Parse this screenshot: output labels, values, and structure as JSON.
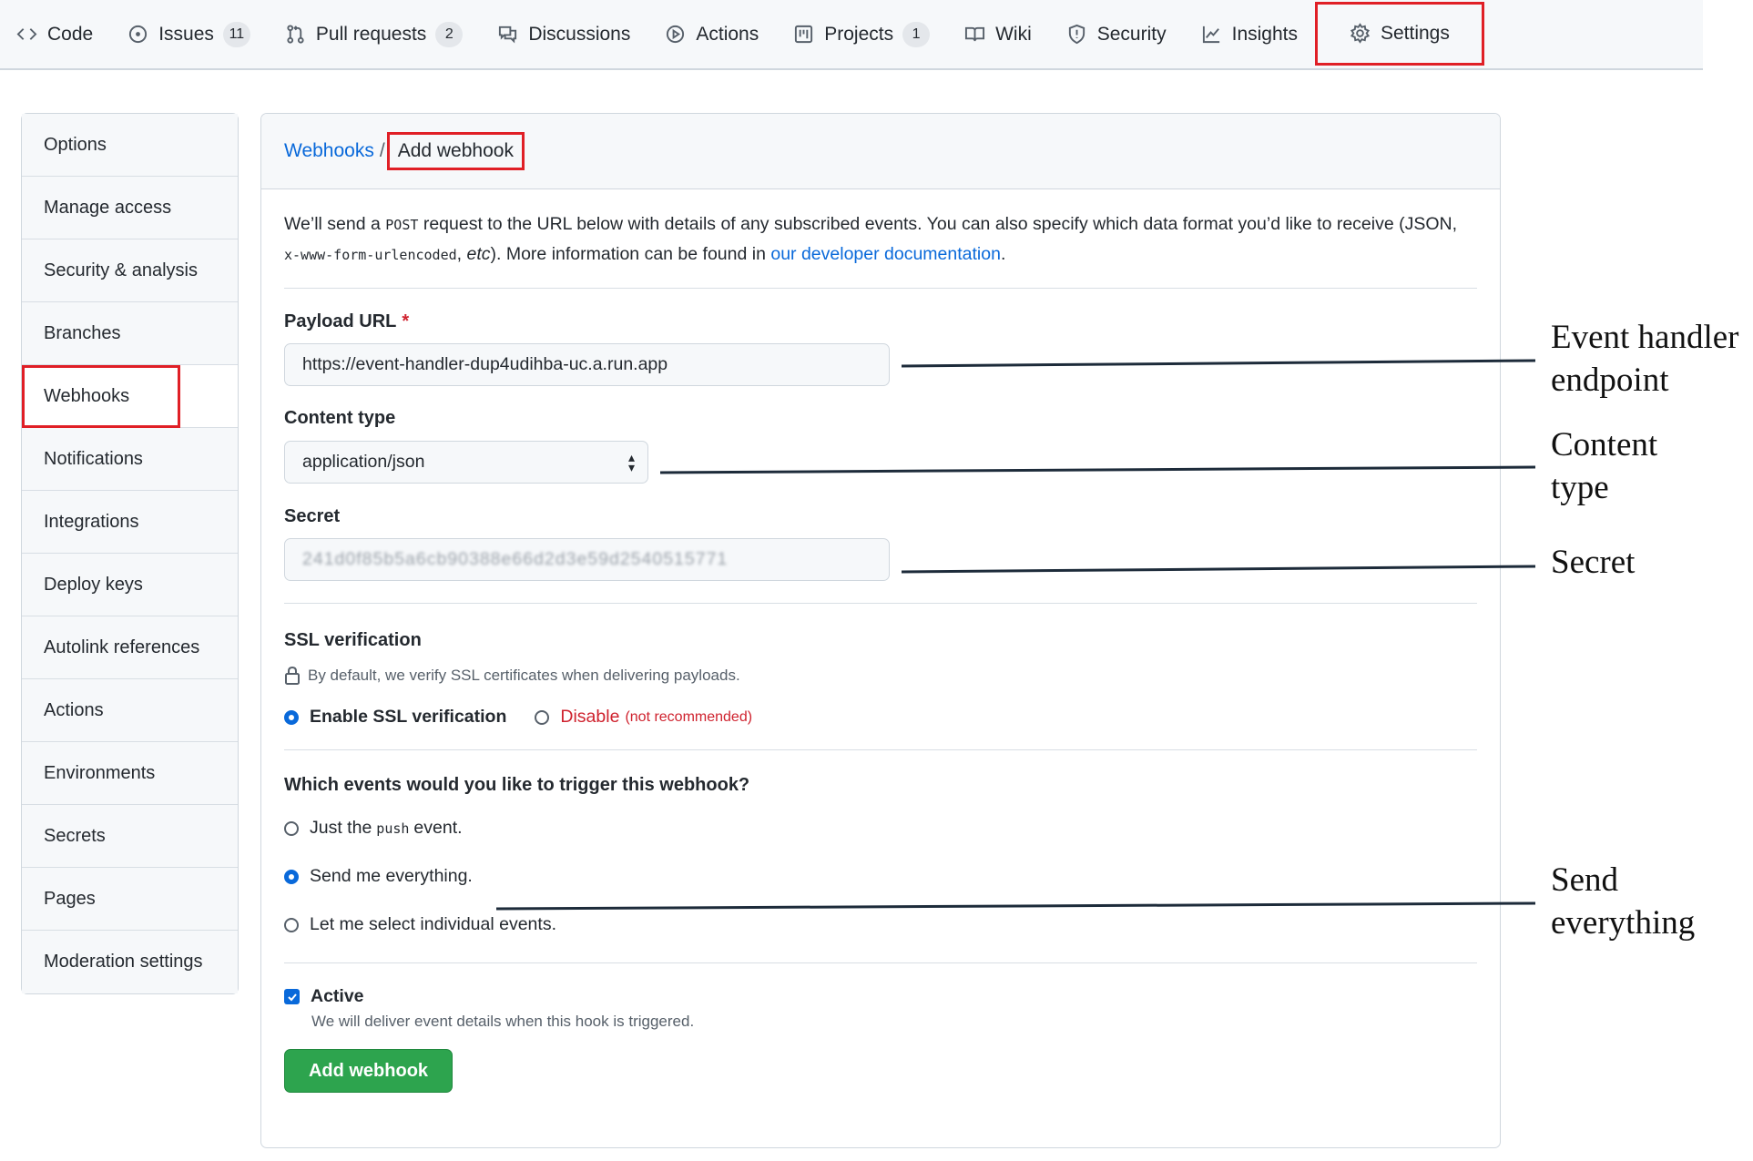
{
  "nav": {
    "tabs": [
      {
        "label": "Code",
        "icon": "code-icon",
        "count": ""
      },
      {
        "label": "Issues",
        "icon": "issue-icon",
        "count": "11"
      },
      {
        "label": "Pull requests",
        "icon": "pull-request-icon",
        "count": "2"
      },
      {
        "label": "Discussions",
        "icon": "discussion-icon",
        "count": ""
      },
      {
        "label": "Actions",
        "icon": "play-icon",
        "count": ""
      },
      {
        "label": "Projects",
        "icon": "project-icon",
        "count": "1"
      },
      {
        "label": "Wiki",
        "icon": "book-icon",
        "count": ""
      },
      {
        "label": "Security",
        "icon": "shield-icon",
        "count": ""
      },
      {
        "label": "Insights",
        "icon": "graph-icon",
        "count": ""
      },
      {
        "label": "Settings",
        "icon": "gear-icon",
        "count": ""
      }
    ],
    "selected": "Settings"
  },
  "sidebar": {
    "items": [
      "Options",
      "Manage access",
      "Security & analysis",
      "Branches",
      "Webhooks",
      "Notifications",
      "Integrations",
      "Deploy keys",
      "Autolink references",
      "Actions",
      "Environments",
      "Secrets",
      "Pages",
      "Moderation settings"
    ],
    "active": "Webhooks"
  },
  "breadcrumb": {
    "parent": "Webhooks",
    "separator": "/",
    "current": "Add webhook"
  },
  "intro": {
    "p1": "We’ll send a ",
    "post": "POST",
    "p2": " request to the URL below with details of any subscribed events. You can also specify which data format you’d like to receive (JSON, ",
    "form": "x-www-form-urlencoded",
    "p3": ", ",
    "etc": "etc",
    "p4": "). More information can be found in ",
    "link": "our developer documentation",
    "p5": "."
  },
  "payload": {
    "label": "Payload URL",
    "required": "*",
    "value": "https://event-handler-dup4udihba-uc.a.run.app"
  },
  "content_type": {
    "label": "Content type",
    "value": "application/json"
  },
  "secret": {
    "label": "Secret",
    "value": "241d0f85b5a6cb90388e66d2d3e59d2540515771"
  },
  "ssl": {
    "label": "SSL verification",
    "note": "By default, we verify SSL certificates when delivering payloads.",
    "enable": "Enable SSL verification",
    "disable": "Disable",
    "disable_note": "(not recommended)"
  },
  "events": {
    "question": "Which events would you like to trigger this webhook?",
    "opt1_pre": "Just the ",
    "opt1_code": "push",
    "opt1_post": " event.",
    "opt2": "Send me everything.",
    "opt3": "Let me select individual events."
  },
  "active": {
    "label": "Active",
    "note": "We will deliver event details when this hook is triggered."
  },
  "submit_label": "Add webhook",
  "annotations": {
    "endpoint": [
      "Event handler",
      "endpoint"
    ],
    "content_type": [
      "Content",
      "type"
    ],
    "secret": [
      "Secret"
    ],
    "everything": [
      "Send",
      "everything"
    ]
  },
  "colors": {
    "highlight": "#e01f26",
    "link": "#0969da",
    "primary": "#2da44e",
    "danger": "#cf222e"
  }
}
